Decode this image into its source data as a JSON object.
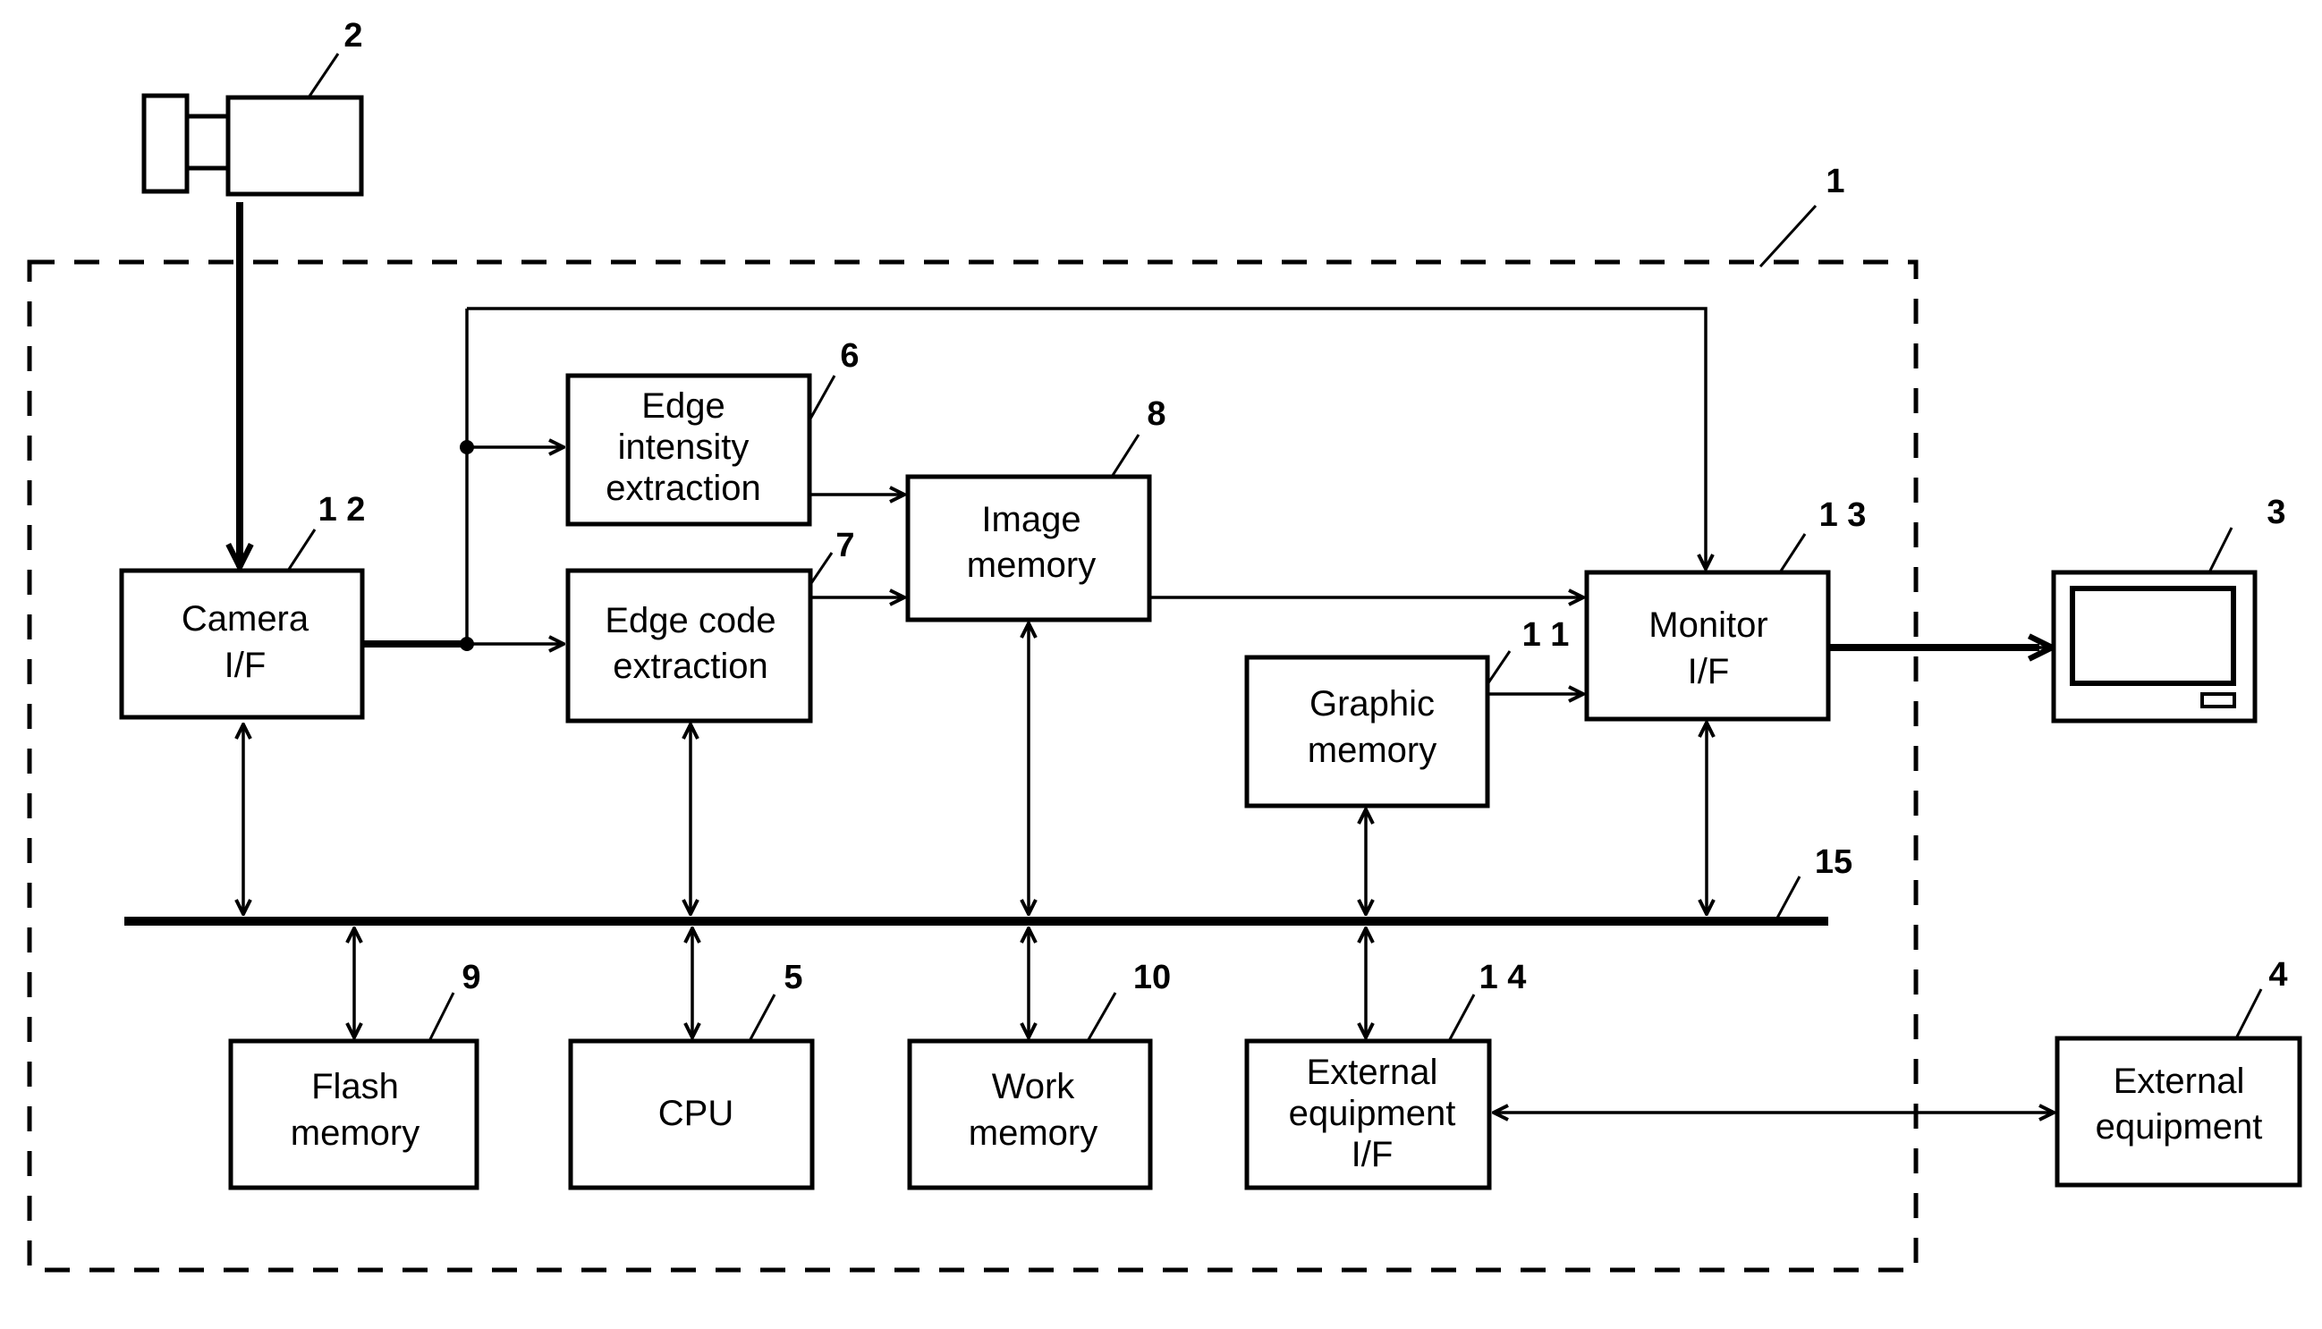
{
  "figure": {
    "system_ref": "1",
    "bus_ref": "15"
  },
  "blocks": {
    "camera": {
      "ref": "2",
      "icon": "camera-icon"
    },
    "monitor": {
      "ref": "3",
      "icon": "monitor-icon"
    },
    "external_equipment": {
      "ref": "4",
      "lines": [
        "External",
        "equipment"
      ]
    },
    "cpu": {
      "ref": "5",
      "lines": [
        "CPU"
      ]
    },
    "edge_intensity": {
      "ref": "6",
      "lines": [
        "Edge",
        "intensity",
        "extraction"
      ]
    },
    "edge_code": {
      "ref": "7",
      "lines": [
        "Edge code",
        "extraction"
      ]
    },
    "image_memory": {
      "ref": "8",
      "lines": [
        "Image",
        "memory"
      ]
    },
    "flash_memory": {
      "ref": "9",
      "lines": [
        "Flash",
        "memory"
      ]
    },
    "work_memory": {
      "ref": "10",
      "lines": [
        "Work",
        "memory"
      ]
    },
    "graphic_memory": {
      "ref": "1 1",
      "lines": [
        "Graphic",
        "memory"
      ]
    },
    "camera_if": {
      "ref": "1 2",
      "lines": [
        "Camera",
        "I/F"
      ]
    },
    "monitor_if": {
      "ref": "1 3",
      "lines": [
        "Monitor",
        "I/F"
      ]
    },
    "external_if": {
      "ref": "1 4",
      "lines": [
        "External",
        "equipment",
        "I/F"
      ]
    }
  },
  "connections": [
    {
      "from": "camera",
      "to": "camera_if",
      "type": "one-way"
    },
    {
      "from": "camera_if",
      "to": "edge_code",
      "type": "one-way"
    },
    {
      "from": "camera_if",
      "to": "edge_intensity",
      "type": "one-way"
    },
    {
      "from": "camera_if",
      "to": "monitor_if",
      "type": "one-way"
    },
    {
      "from": "edge_intensity",
      "to": "image_memory",
      "type": "one-way"
    },
    {
      "from": "edge_code",
      "to": "image_memory",
      "type": "one-way"
    },
    {
      "from": "image_memory",
      "to": "monitor_if",
      "type": "one-way"
    },
    {
      "from": "graphic_memory",
      "to": "monitor_if",
      "type": "one-way"
    },
    {
      "from": "monitor_if",
      "to": "monitor",
      "type": "one-way"
    },
    {
      "from": "external_if",
      "to": "external_equipment",
      "type": "two-way"
    },
    {
      "from": "camera_if",
      "to": "bus",
      "type": "two-way"
    },
    {
      "from": "edge_code",
      "to": "bus",
      "type": "two-way"
    },
    {
      "from": "image_memory",
      "to": "bus",
      "type": "two-way"
    },
    {
      "from": "graphic_memory",
      "to": "bus",
      "type": "two-way"
    },
    {
      "from": "monitor_if",
      "to": "bus",
      "type": "two-way"
    },
    {
      "from": "flash_memory",
      "to": "bus",
      "type": "two-way"
    },
    {
      "from": "cpu",
      "to": "bus",
      "type": "two-way"
    },
    {
      "from": "work_memory",
      "to": "bus",
      "type": "two-way"
    },
    {
      "from": "external_if",
      "to": "bus",
      "type": "two-way"
    }
  ]
}
